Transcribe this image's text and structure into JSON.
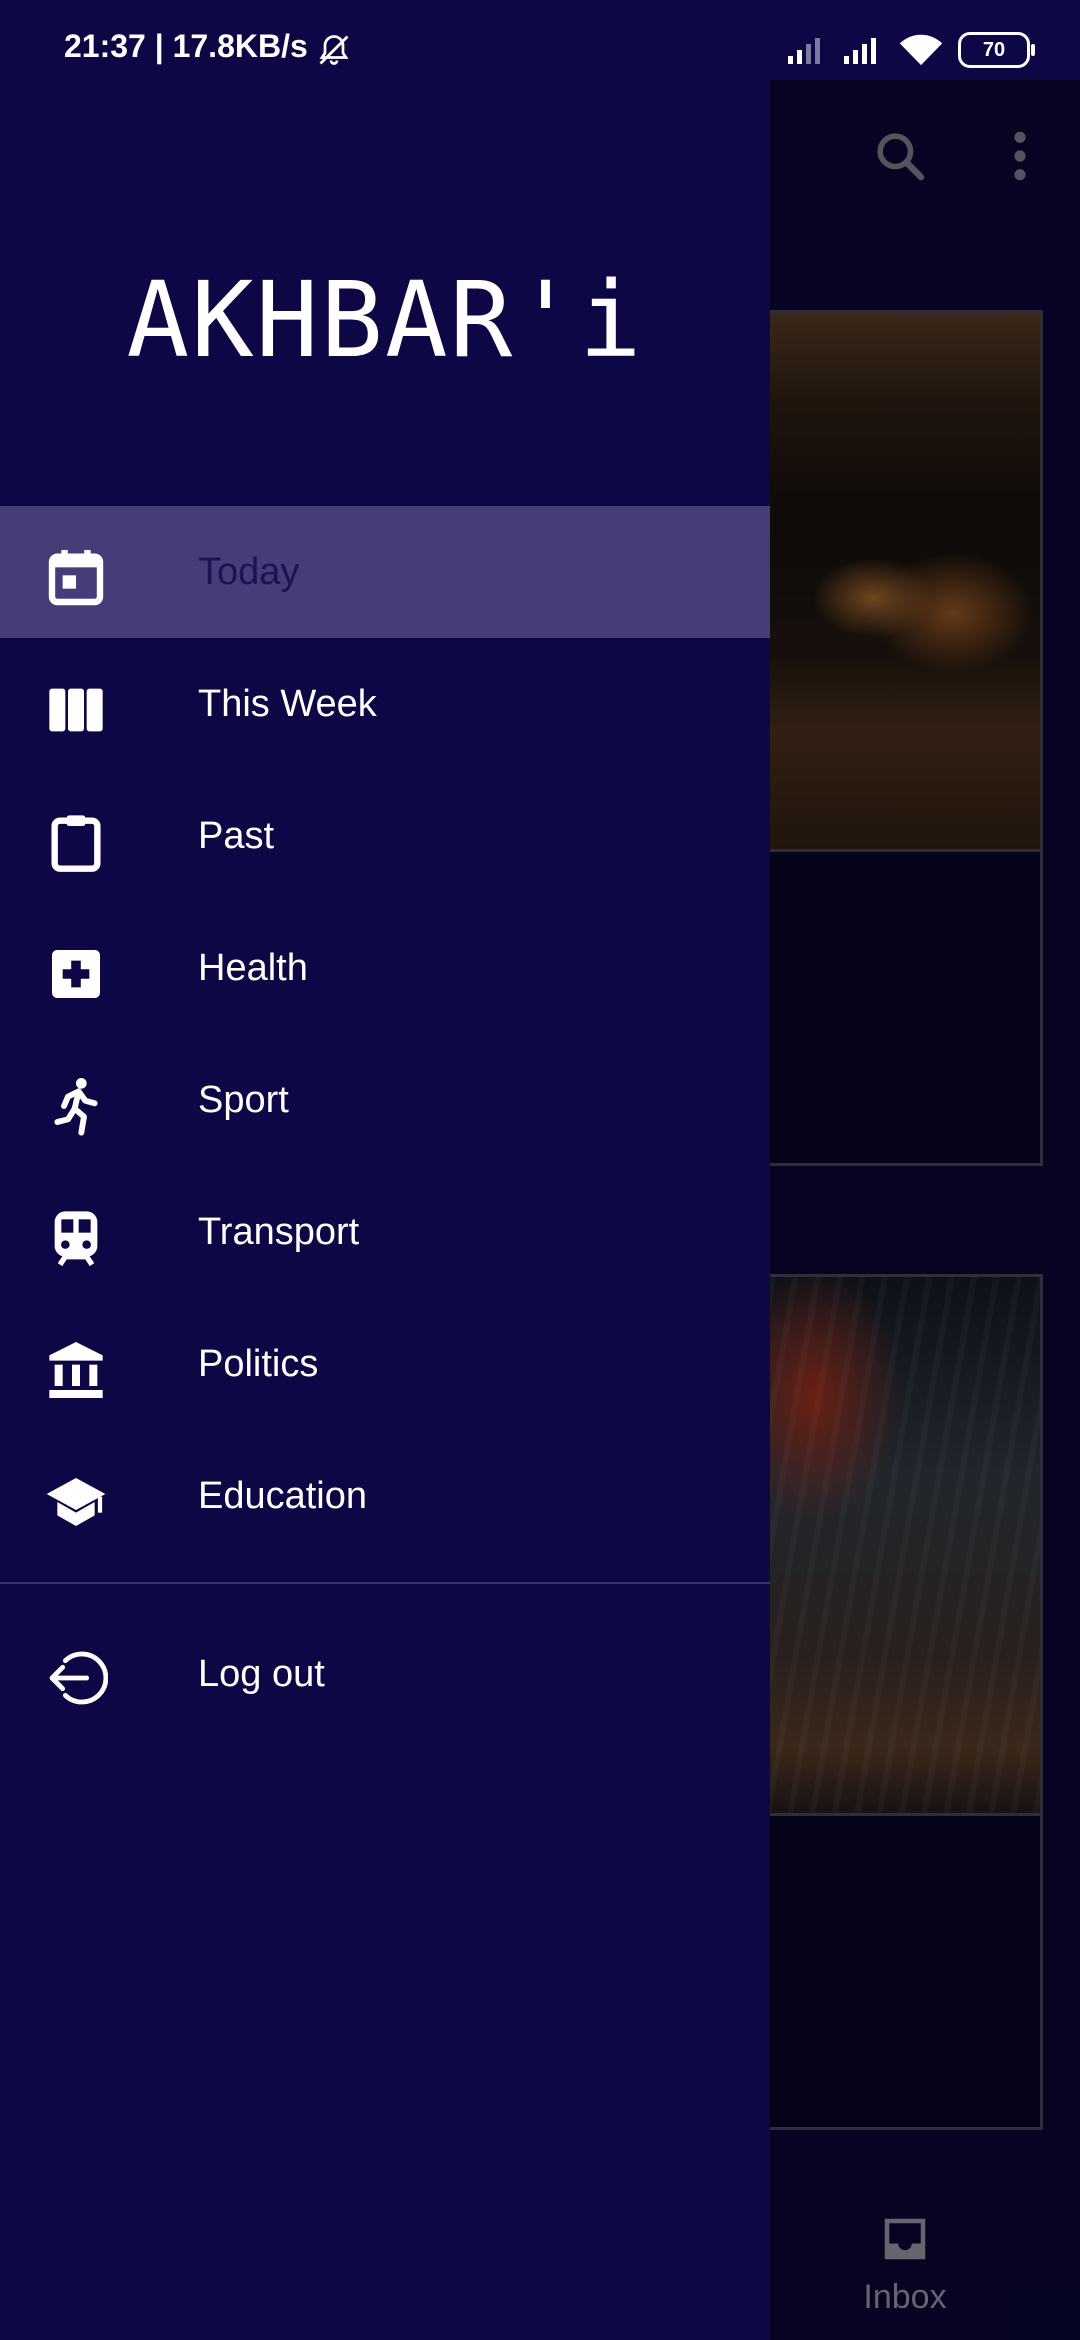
{
  "status_bar": {
    "time": "21:37 | 17.8KB/s",
    "battery": "70"
  },
  "drawer": {
    "app_title": "AKHBAR'i",
    "menu_items": [
      {
        "label": "Today",
        "icon": "calendar-icon",
        "selected": true
      },
      {
        "label": "This Week",
        "icon": "week-columns-icon",
        "selected": false
      },
      {
        "label": "Past",
        "icon": "clipboard-icon",
        "selected": false
      },
      {
        "label": "Health",
        "icon": "medical-cross-icon",
        "selected": false
      },
      {
        "label": "Sport",
        "icon": "running-icon",
        "selected": false
      },
      {
        "label": "Transport",
        "icon": "train-icon",
        "selected": false
      },
      {
        "label": "Politics",
        "icon": "institution-icon",
        "selected": false
      },
      {
        "label": "Education",
        "icon": "graduation-cap-icon",
        "selected": false
      }
    ],
    "logout_label": "Log out"
  },
  "background": {
    "bottom_nav_label": "Inbox"
  },
  "colors": {
    "drawer_bg": "#0d0845",
    "selected_bg": "#443d78",
    "text": "#ffffff"
  }
}
